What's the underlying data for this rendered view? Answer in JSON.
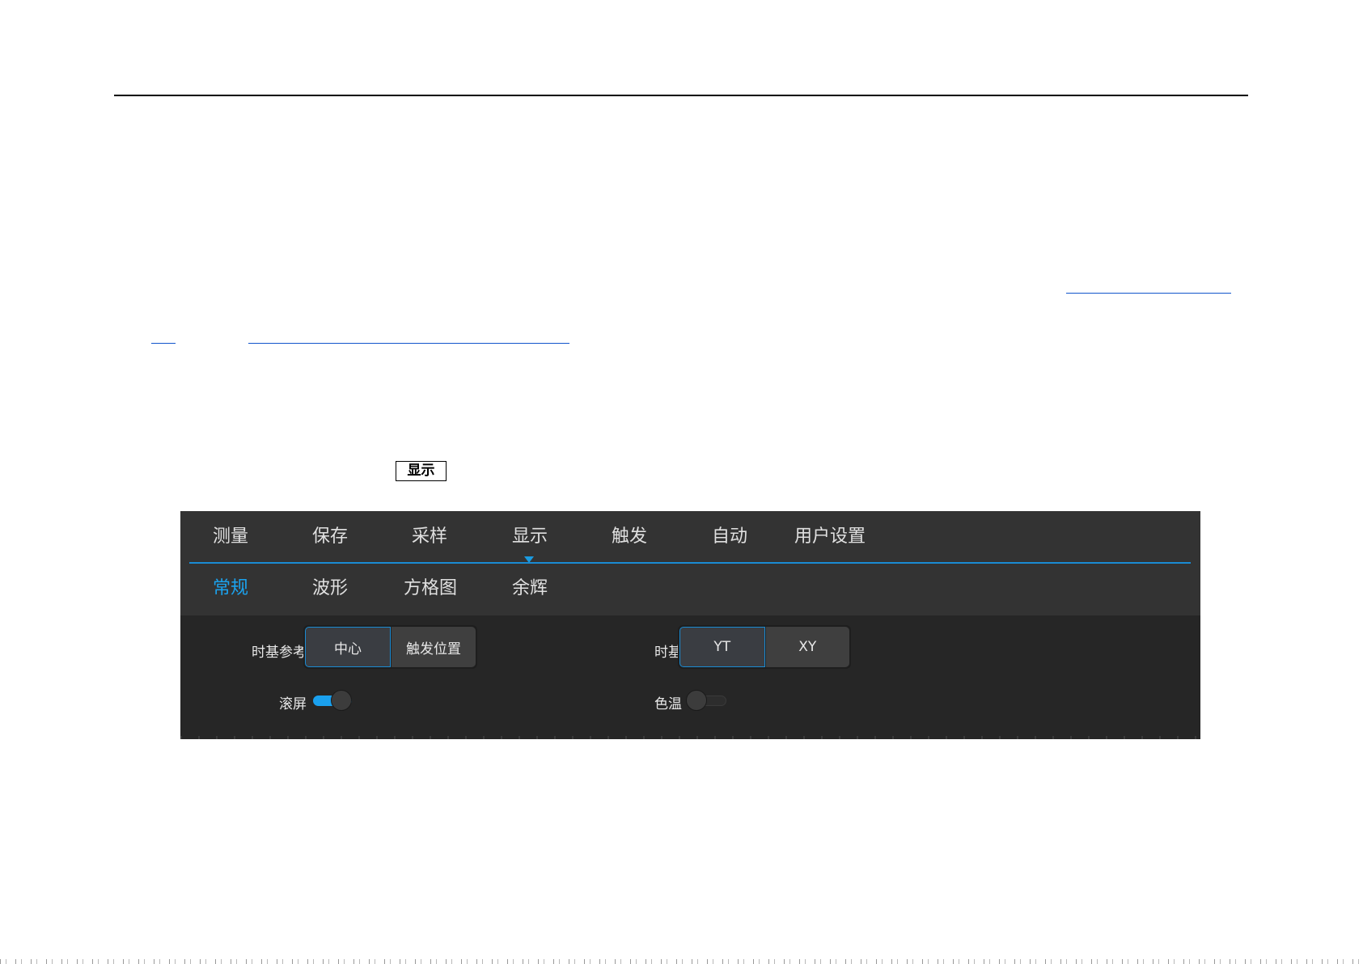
{
  "reference_button": {
    "label": "显示"
  },
  "main_menu": {
    "items": [
      "测量",
      "保存",
      "采样",
      "显示",
      "触发",
      "自动",
      "用户设置"
    ],
    "active": "显示"
  },
  "sub_menu": {
    "items": [
      "常规",
      "波形",
      "方格图",
      "余辉"
    ],
    "active": "常规"
  },
  "options": {
    "timebase_reference": {
      "label": "时基参考",
      "choices": [
        "中心",
        "触发位置"
      ],
      "selected": "中心"
    },
    "timebase": {
      "label": "时基",
      "choices": [
        "YT",
        "XY"
      ],
      "selected": "YT"
    },
    "scroll": {
      "label": "滚屏",
      "on": true
    },
    "color_temp": {
      "label": "色温",
      "on": false
    }
  },
  "colors": {
    "accent": "#1ba3ef",
    "panel_bg": "#262626",
    "menu_bg": "#333333"
  }
}
